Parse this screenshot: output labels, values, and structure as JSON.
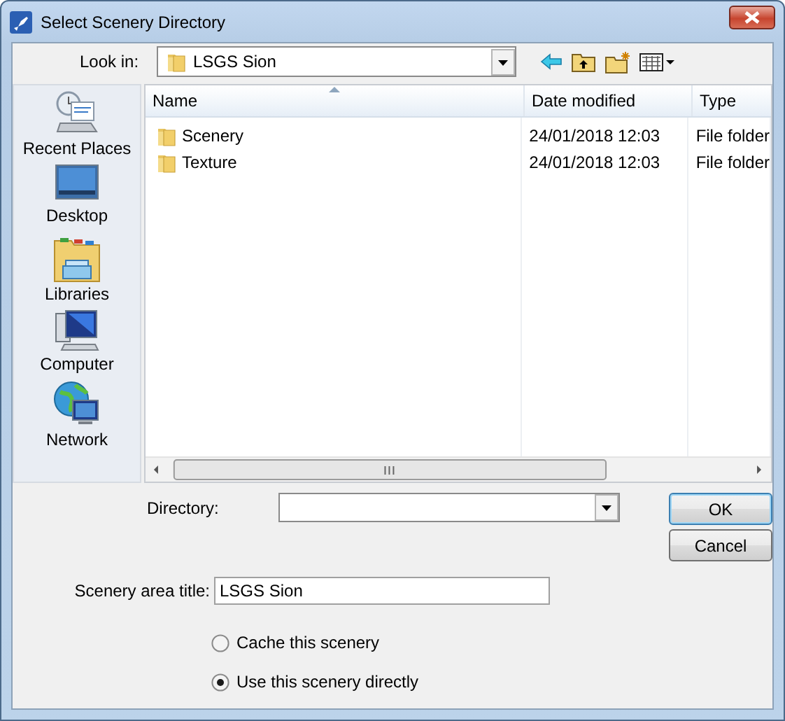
{
  "window": {
    "title": "Select Scenery Directory"
  },
  "look_in": {
    "label": "Look in:",
    "value": "LSGS Sion"
  },
  "toolbar": [
    {
      "kind": "back"
    },
    {
      "kind": "up"
    },
    {
      "kind": "new_folder"
    },
    {
      "kind": "view"
    }
  ],
  "places": [
    {
      "label": "Recent Places",
      "kind": "recent"
    },
    {
      "label": "Desktop",
      "kind": "desktop"
    },
    {
      "label": "Libraries",
      "kind": "libraries"
    },
    {
      "label": "Computer",
      "kind": "computer"
    },
    {
      "label": "Network",
      "kind": "network"
    }
  ],
  "file_list": {
    "columns": [
      {
        "label": "Name",
        "sorted": true
      },
      {
        "label": "Date modified",
        "sorted": false
      },
      {
        "label": "Type",
        "sorted": false
      }
    ],
    "rows": [
      {
        "name": "Scenery",
        "date": "24/01/2018 12:03",
        "type": "File folder"
      },
      {
        "name": "Texture",
        "date": "24/01/2018 12:03",
        "type": "File folder"
      }
    ]
  },
  "directory": {
    "label": "Directory:"
  },
  "buttons": [
    {
      "label": "OK",
      "default": true
    },
    {
      "label": "Cancel",
      "default": false
    }
  ],
  "scenery_title": {
    "label": "Scenery area title:",
    "value": "LSGS Sion"
  },
  "options": [
    {
      "label": "Cache this scenery",
      "selected": false
    },
    {
      "label": "Use this scenery directly",
      "selected": true
    }
  ]
}
